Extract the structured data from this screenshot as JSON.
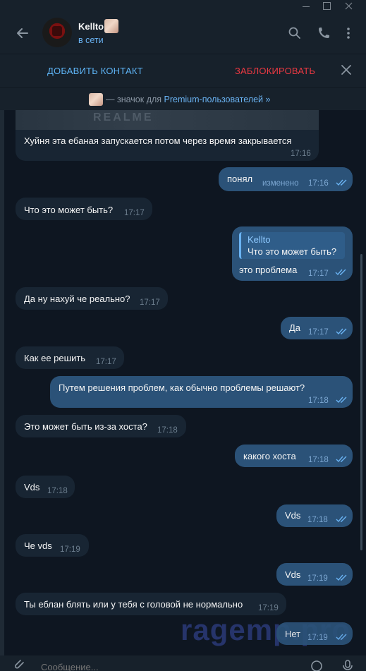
{
  "header": {
    "name": "Kellto",
    "status": "в сети"
  },
  "actionbar": {
    "add_contact": "ДОБАВИТЬ КОНТАКТ",
    "block": "ЗАБЛОКИРОВАТЬ"
  },
  "premium": {
    "prefix": "— значок для ",
    "link": "Premium-пользователей »"
  },
  "messages": [
    {
      "dir": "in",
      "text": "Хуйня эта ебаная запускается потом через время закрывается",
      "time": "17:16"
    },
    {
      "dir": "out",
      "text": "понял",
      "edited": "изменено",
      "time": "17:16"
    },
    {
      "dir": "in",
      "text": "Что это может быть?",
      "time": "17:17"
    },
    {
      "dir": "out",
      "reply_name": "Kellto",
      "reply_text": "Что это может быть?",
      "text": "это проблема",
      "time": "17:17"
    },
    {
      "dir": "in",
      "text": "Да ну нахуй че реально?",
      "time": "17:17"
    },
    {
      "dir": "out",
      "text": "Да",
      "time": "17:17"
    },
    {
      "dir": "in",
      "text": "Как ее решить",
      "time": "17:17"
    },
    {
      "dir": "out",
      "text": "Путем решения проблем, как обычно проблемы решают?",
      "time": "17:18"
    },
    {
      "dir": "in",
      "text": "Это может быть из-за хоста?",
      "time": "17:18"
    },
    {
      "dir": "out",
      "text": "какого хоста",
      "time": "17:18"
    },
    {
      "dir": "in",
      "text": "Vds",
      "time": "17:18"
    },
    {
      "dir": "out",
      "text": "Vds",
      "time": "17:18"
    },
    {
      "dir": "in",
      "text": "Че vds",
      "time": "17:19"
    },
    {
      "dir": "out",
      "text": "Vds",
      "time": "17:19"
    },
    {
      "dir": "in",
      "text": "Ты еблан блять или у тебя с головой не нормально",
      "time": "17:19"
    },
    {
      "dir": "out",
      "text": "Нет",
      "time": "17:19"
    }
  ],
  "image_preview_text": "REALME",
  "watermark": "ragemp.pro",
  "composer": {
    "placeholder": "Сообщение..."
  },
  "colors": {
    "accent": "#6ab3f3",
    "block": "#ec3942",
    "outgoing_bubble": "#2b5278",
    "incoming_bubble": "#182533",
    "background": "#0e1621"
  }
}
